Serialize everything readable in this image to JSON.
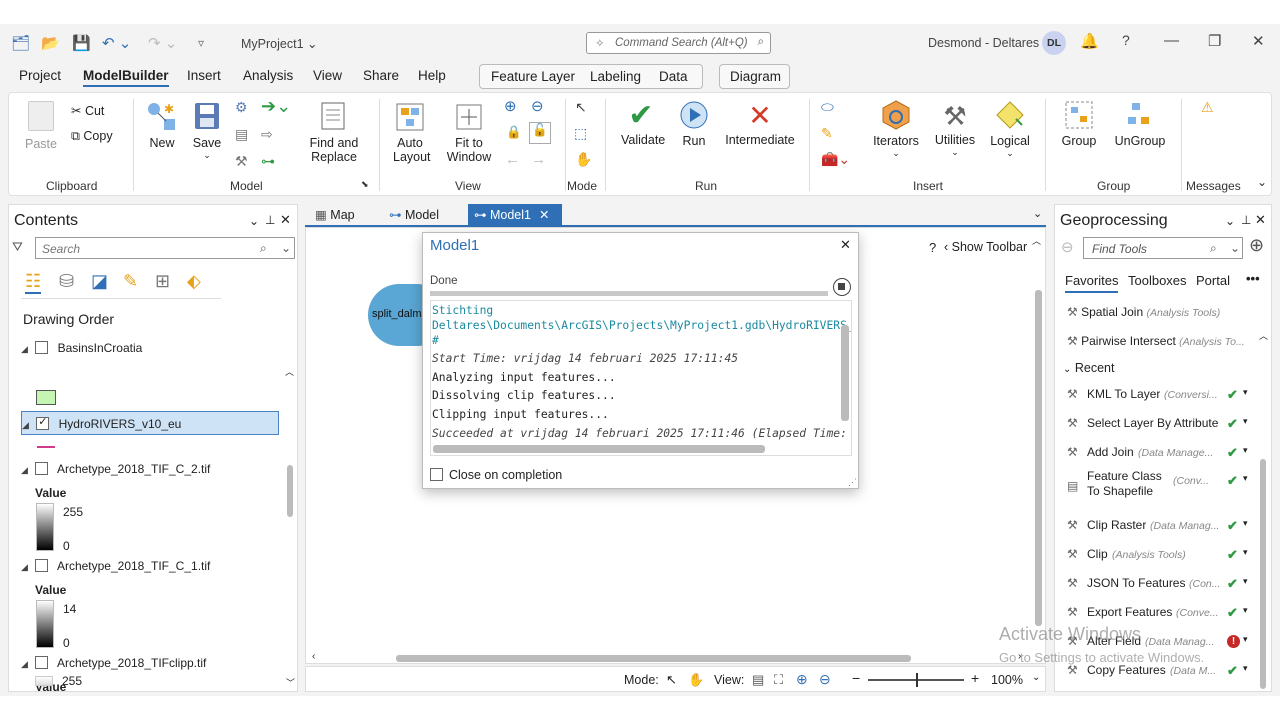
{
  "app": {
    "project_name": "MyProject1",
    "user_name": "Desmond - Deltares",
    "avatar_initials": "DL",
    "help": "?"
  },
  "search": {
    "command_placeholder": "Command Search (Alt+Q)"
  },
  "menu": {
    "items": [
      "Project",
      "ModelBuilder",
      "Insert",
      "Analysis",
      "View",
      "Share",
      "Help"
    ],
    "contextual": [
      "Feature Layer",
      "Labeling",
      "Data"
    ],
    "diagram": "Diagram"
  },
  "ribbon": {
    "clipboard": {
      "paste": "Paste",
      "cut": "Cut",
      "copy": "Copy",
      "group": "Clipboard"
    },
    "model": {
      "new": "New",
      "save": "Save",
      "find_replace": [
        "Find and",
        "Replace"
      ],
      "group": "Model"
    },
    "view": {
      "auto_layout": [
        "Auto",
        "Layout"
      ],
      "fit_window": [
        "Fit to",
        "Window"
      ],
      "group": "View"
    },
    "mode": {
      "group": "Mode"
    },
    "run": {
      "validate": "Validate",
      "run": "Run",
      "intermediate": "Intermediate",
      "group": "Run"
    },
    "insert": {
      "iterators": "Iterators",
      "utilities": "Utilities",
      "logical": "Logical",
      "group": "Insert"
    },
    "groupg": {
      "group_btn": "Group",
      "ungroup": "UnGroup",
      "group": "Group"
    },
    "messages": {
      "group": "Messages"
    }
  },
  "contents": {
    "title": "Contents",
    "search_placeholder": "Search",
    "drawing_order": "Drawing Order",
    "layers": [
      {
        "name": "BasinsInCroatia",
        "checked": false
      },
      {
        "name": "HydroRIVERS_v10_eu",
        "checked": true
      },
      {
        "name": "Archetype_2018_TIF_C_2.tif",
        "value_label": "Value",
        "max": "255",
        "min": "0"
      },
      {
        "name": "Archetype_2018_TIF_C_1.tif",
        "value_label": "Value",
        "max": "14",
        "min": "0"
      },
      {
        "name": "Archetype_2018_TIFclipp.tif",
        "value_label": "Value",
        "max": "255"
      }
    ]
  },
  "tabs": [
    {
      "label": "Map",
      "active": false
    },
    {
      "label": "Model",
      "active": false
    },
    {
      "label": "Model1",
      "active": true
    }
  ],
  "canvas": {
    "show_toolbar": "Show Toolbar",
    "help": "?",
    "node_label": "split_dalm"
  },
  "dialog": {
    "title": "Model1",
    "status": "Done",
    "progress": 1.0,
    "log": [
      {
        "text": "Stichting",
        "style": "path"
      },
      {
        "text": "Deltares\\Documents\\ArcGIS\\Projects\\MyProject1.gdb\\HydroRIVERS_",
        "style": "path"
      },
      {
        "text": "#",
        "style": "path"
      },
      {
        "text": "Start Time: vrijdag 14 februari 2025 17:11:45",
        "style": "italic"
      },
      {
        "text": "Analyzing input features...",
        "style": "normal"
      },
      {
        "text": "Dissolving clip features...",
        "style": "normal"
      },
      {
        "text": "Clipping input features...",
        "style": "normal"
      },
      {
        "text": "Succeeded at vrijdag 14 februari 2025 17:11:46 (Elapsed Time:",
        "style": "italic"
      }
    ],
    "close_on_completion": "Close on completion"
  },
  "statusbar": {
    "mode_label": "Mode:",
    "view_label": "View:",
    "zoom": "100%"
  },
  "geoprocessing": {
    "title": "Geoprocessing",
    "search_placeholder": "Find Tools",
    "tabs": [
      "Favorites",
      "Toolboxes",
      "Portal"
    ],
    "more": "•••",
    "favorites": [
      {
        "name": "Spatial Join",
        "box": "(Analysis Tools)"
      },
      {
        "name": "Pairwise Intersect",
        "box": "(Analysis To..."
      }
    ],
    "recent_label": "Recent",
    "recent": [
      {
        "name": "KML To Layer",
        "box": "(Conversi...",
        "status": "ok"
      },
      {
        "name": "Select Layer By Attribute",
        "box": "",
        "status": "ok"
      },
      {
        "name": "Add Join",
        "box": "(Data Manage...",
        "status": "ok"
      },
      {
        "name": "Feature Class To Shapefile",
        "box": "(Conv...",
        "status": "ok"
      },
      {
        "name": "Clip Raster",
        "box": "(Data Manag...",
        "status": "ok"
      },
      {
        "name": "Clip",
        "box": "(Analysis Tools)",
        "status": "ok"
      },
      {
        "name": "JSON To Features",
        "box": "(Con...",
        "status": "ok"
      },
      {
        "name": "Export Features",
        "box": "(Conve...",
        "status": "ok"
      },
      {
        "name": "Alter Field",
        "box": "(Data Manag...",
        "status": "error"
      },
      {
        "name": "Copy Features",
        "box": "(Data M...",
        "status": "ok"
      }
    ]
  },
  "watermark": {
    "line1": "Activate Windows",
    "line2": "Go to Settings to activate Windows."
  },
  "colors": {
    "accent": "#2f6fb5",
    "check": "#2e9a44",
    "error": "#c62828",
    "selection": "#cfe3f7"
  }
}
